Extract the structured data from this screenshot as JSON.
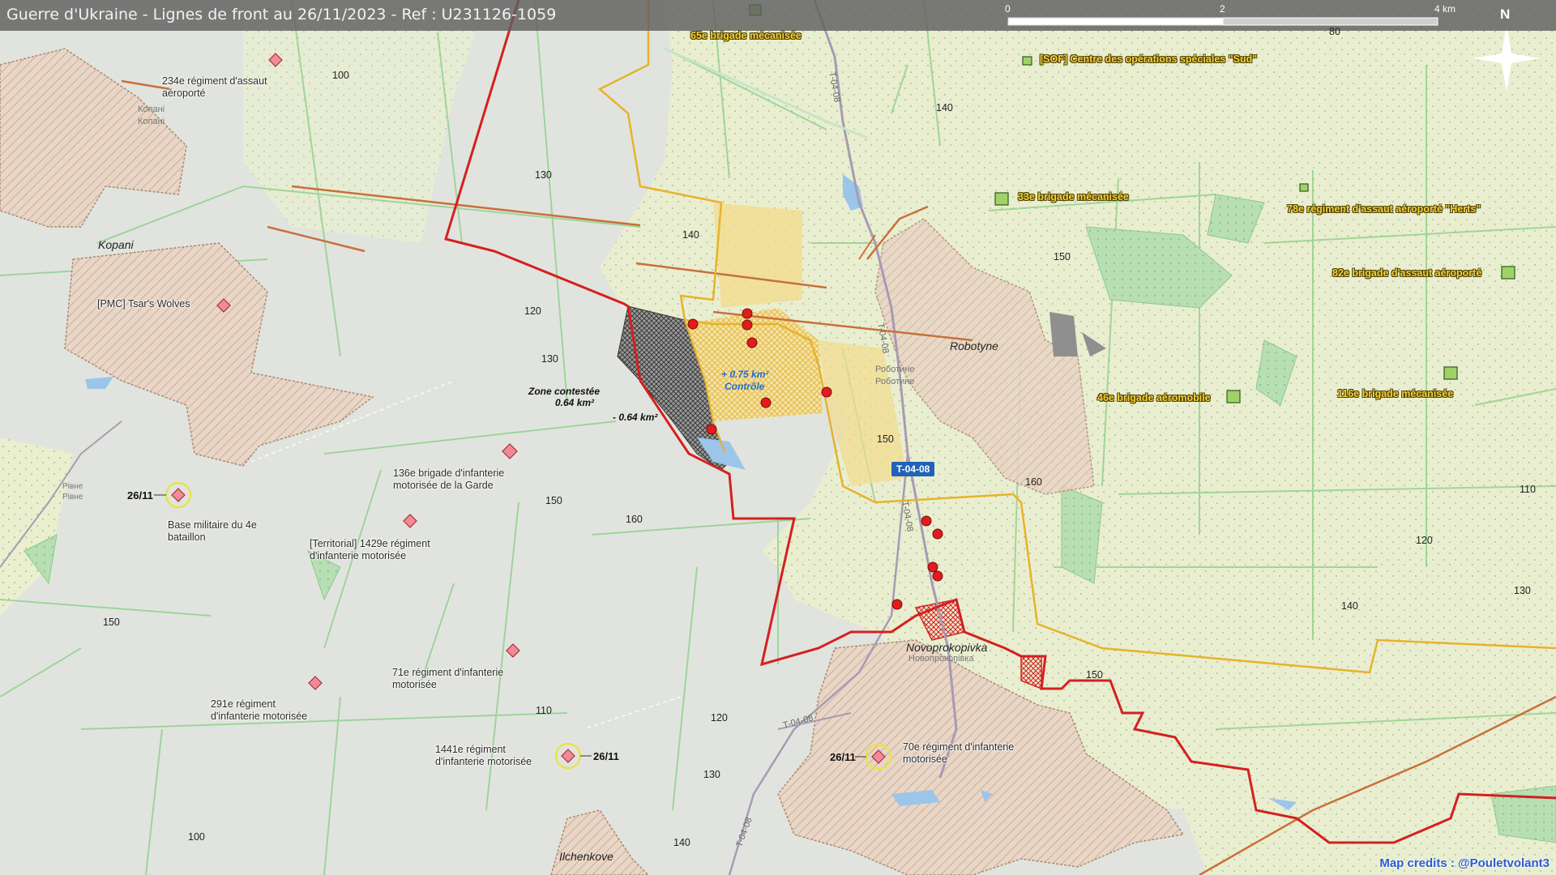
{
  "title": "Guerre d'Ukraine - Lignes de front au 26/11/2023 - Ref : U231126-1059",
  "scale": {
    "start": "0",
    "mid": "2",
    "end": "4 km"
  },
  "north": "N",
  "credits": "Map credits : @Pouletvolant3",
  "road_badge": "T-04-08",
  "colors": {
    "ru_line": "#d42020",
    "ua_line": "#e7b22c",
    "ru_unit": "#f08a9a",
    "ua_unit": "#9fd36a"
  },
  "places": {
    "kopani": "Kopani",
    "kopani_small": "Копані",
    "robotyne": "Robotyne",
    "robotyne_small": "Роботине",
    "novoprokopivka": "Novoprokopivka",
    "novoprokopivka_small": "Новопрокопівка",
    "ilchenkove": "Ilchenkove",
    "rivne": "Рівне"
  },
  "zones": {
    "contested_title": "Zone contestée",
    "contested_area": "0.64 km²",
    "loss": "- 0.64 km²",
    "gain": "+ 0.75 km²",
    "gain_label": "Contrôle"
  },
  "ru_units": {
    "u234": "234e régiment d'assaut aéroporté",
    "pmc": "[PMC] Tsar's Wolves",
    "u136": "136e brigade d'infanterie motorisée de la Garde",
    "base4": "Base militaire du 4e bataillon",
    "u1429": "[Territorial] 1429e régiment d'infanterie motorisée",
    "u71": "71e régiment d'infanterie motorisée",
    "u291": "291e régiment d'infanterie motorisée",
    "u1441": "1441e régiment d'infanterie motorisée",
    "u70": "70e régiment d'infanterie motorisée"
  },
  "ua_units": {
    "u65": "65e brigade mécanisée",
    "sof": "[SOF] Centre des opérations spéciales \"Sud\"",
    "u33": "33e brigade mécanisée",
    "u78": "78e régiment d'assaut aéroporté \"Herts\"",
    "u82": "82e brigade d'assaut aéroporté",
    "u46": "46e brigade aéromobile",
    "u116": "116e brigade mécanisée"
  },
  "dates": {
    "d1": "26/11",
    "d2": "26/11",
    "d3": "26/11"
  },
  "elevations": [
    "80",
    "100",
    "140",
    "130",
    "140",
    "120",
    "130",
    "150",
    "160",
    "150",
    "160",
    "150",
    "120",
    "140",
    "130",
    "110",
    "150",
    "110",
    "120",
    "130",
    "140",
    "100"
  ],
  "road_labels": [
    "T-04-08",
    "T-04-08",
    "T-04-08",
    "T-04-08",
    "T-04-08"
  ]
}
